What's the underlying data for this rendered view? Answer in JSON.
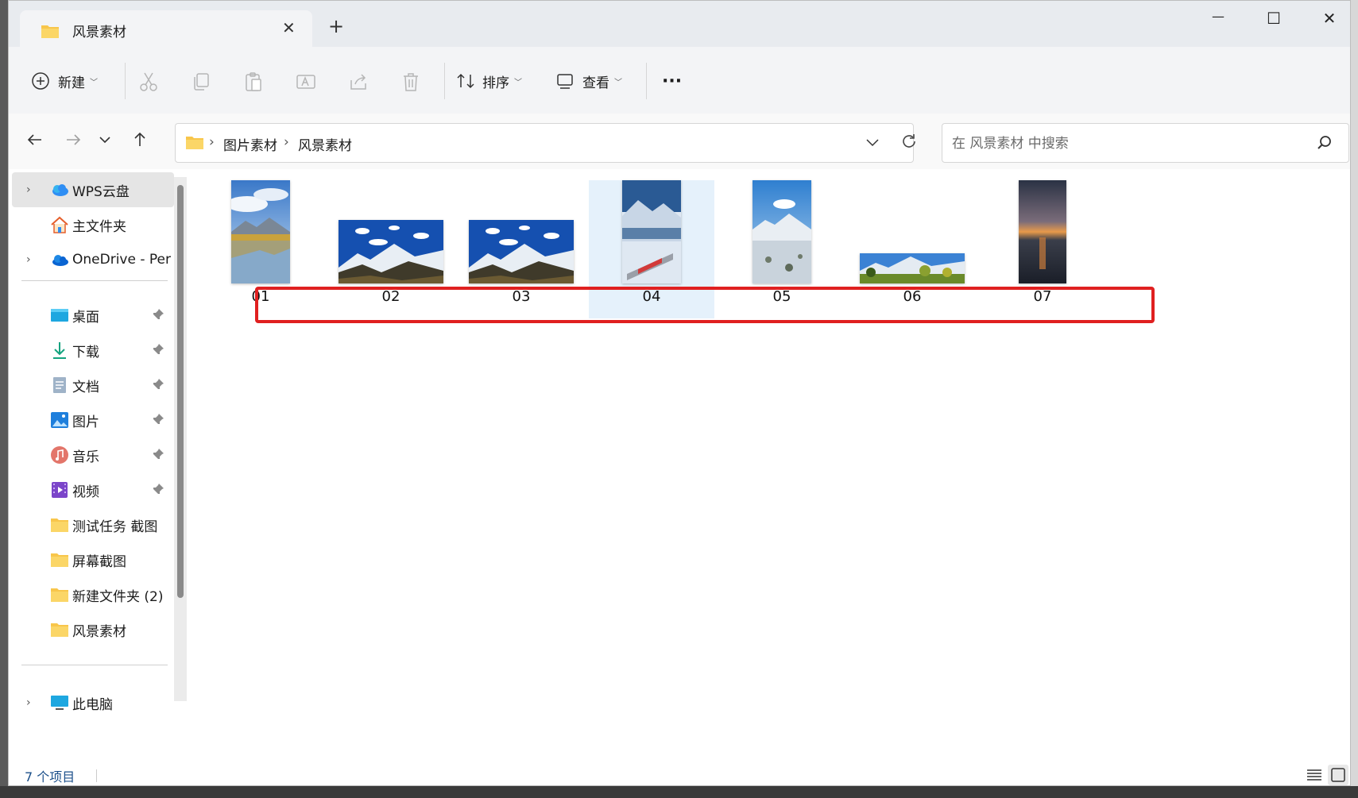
{
  "window": {
    "tab_title": "风景素材",
    "new_tab": "+",
    "minimize": "—",
    "maximize": "☐",
    "close": "✕"
  },
  "toolbar": {
    "new_label": "新建",
    "sort_label": "排序",
    "view_label": "查看",
    "more_label": "···"
  },
  "address": {
    "crumbs": [
      "图片素材",
      "风景素材"
    ],
    "separator": "›"
  },
  "search": {
    "placeholder": "在 风景素材 中搜索"
  },
  "sidebar": {
    "top_items": [
      {
        "label": "WPS云盘",
        "icon": "cloud-icon"
      },
      {
        "label": "主文件夹",
        "icon": "home-icon"
      },
      {
        "label": "OneDrive - Per",
        "icon": "onedrive-icon"
      }
    ],
    "quick_access": [
      {
        "label": "桌面",
        "icon": "desktop-icon",
        "pinned": true
      },
      {
        "label": "下载",
        "icon": "download-icon",
        "pinned": true
      },
      {
        "label": "文档",
        "icon": "document-icon",
        "pinned": true
      },
      {
        "label": "图片",
        "icon": "pictures-icon",
        "pinned": true
      },
      {
        "label": "音乐",
        "icon": "music-icon",
        "pinned": true
      },
      {
        "label": "视频",
        "icon": "video-icon",
        "pinned": true
      },
      {
        "label": "测试任务 截图",
        "icon": "folder-icon",
        "pinned": false
      },
      {
        "label": "屏幕截图",
        "icon": "folder-icon",
        "pinned": false
      },
      {
        "label": "新建文件夹 (2)",
        "icon": "folder-icon",
        "pinned": false
      },
      {
        "label": "风景素材",
        "icon": "folder-icon",
        "pinned": false
      }
    ],
    "bottom_item": {
      "label": "此电脑",
      "icon": "pc-icon"
    }
  },
  "files": [
    {
      "name": "01",
      "selected": false
    },
    {
      "name": "02",
      "selected": false
    },
    {
      "name": "03",
      "selected": false
    },
    {
      "name": "04",
      "selected": true
    },
    {
      "name": "05",
      "selected": false
    },
    {
      "name": "06",
      "selected": false
    },
    {
      "name": "07",
      "selected": false
    }
  ],
  "status": {
    "item_count": "7 个项目"
  },
  "colors": {
    "accent": "#0067c0",
    "selection": "#e5f1fb",
    "highlight_box": "#e02020",
    "folder": "#f8c64b"
  }
}
